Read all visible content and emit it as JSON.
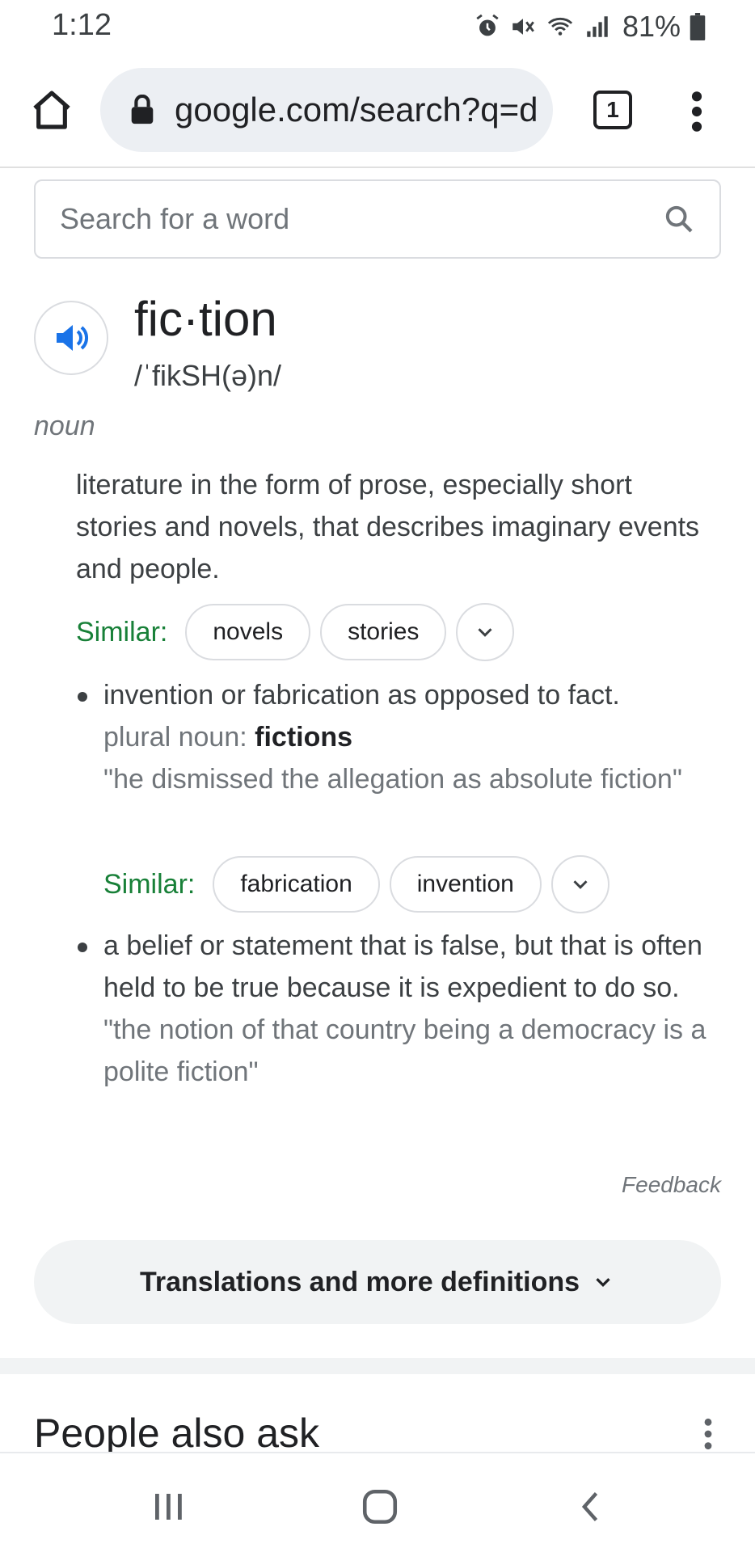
{
  "status_bar": {
    "time": "1:12",
    "battery": "81%",
    "icons": [
      "alarm-icon",
      "mute-icon",
      "wifi-icon",
      "signal-icon",
      "battery-icon"
    ]
  },
  "browser": {
    "url": "google.com/search?q=d",
    "tab_count": "1"
  },
  "dictionary": {
    "search_placeholder": "Search for a word",
    "word": "fic·tion",
    "phonetic": "/ˈfikSH(ə)n/",
    "part_of_speech": "noun",
    "main_definition": "literature in the form of prose, especially short stories and novels, that describes imaginary events and people.",
    "similar_label": "Similar:",
    "main_similar": [
      "novels",
      "stories"
    ],
    "senses": [
      {
        "definition": "invention or fabrication as opposed to fact.",
        "plural_label": "plural noun: ",
        "plural_value": "fictions",
        "example": "\"he dismissed the allegation as absolute fiction\"",
        "similar": [
          "fabrication",
          "invention"
        ]
      },
      {
        "definition": "a belief or statement that is false, but that is often held to be true because it is expedient to do so.",
        "example": "\"the notion of that country being a democracy is a polite fiction\""
      }
    ],
    "feedback": "Feedback",
    "more_button": "Translations and more definitions"
  },
  "people_also_ask": {
    "title": "People also ask"
  },
  "colors": {
    "similar_green": "#188038",
    "audio_blue": "#1a73e8",
    "pill_bg": "#eceff3"
  }
}
